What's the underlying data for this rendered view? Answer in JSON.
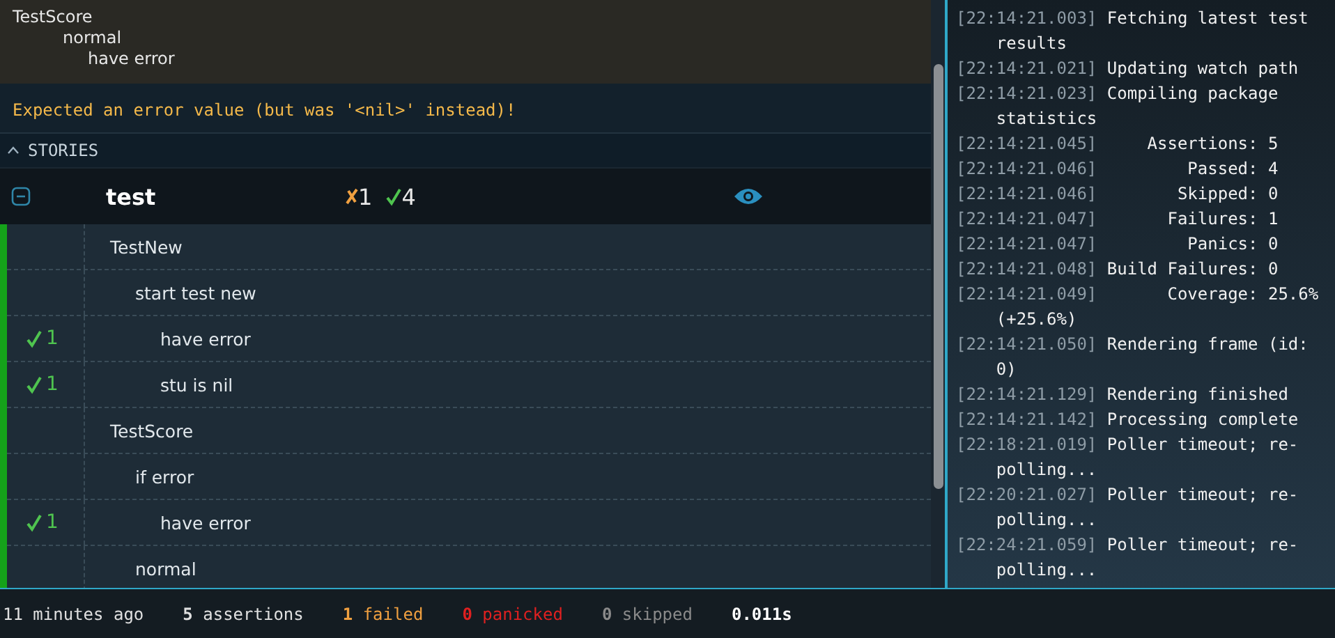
{
  "failure": {
    "lines": [
      "TestScore",
      "normal",
      "have error"
    ],
    "message": "Expected an error value (but was '<nil>' instead)!"
  },
  "stories_header": {
    "label": "STORIES",
    "expanded": true
  },
  "test": {
    "name": "test",
    "expanded": true,
    "failed": "1",
    "passed": "4"
  },
  "stories": [
    {
      "label": "TestNew",
      "children": [
        {
          "label": "start test new",
          "children": [
            {
              "label": "have error",
              "passed": "1"
            },
            {
              "label": "stu is nil",
              "passed": "1"
            }
          ]
        }
      ]
    },
    {
      "label": "TestScore",
      "children": [
        {
          "label": "if error",
          "children": [
            {
              "label": "have error",
              "passed": "1"
            }
          ]
        },
        {
          "label": "normal"
        }
      ]
    }
  ],
  "log": [
    {
      "time": "[22:14:21.003]",
      "kind": "msg",
      "text": "Fetching latest test results"
    },
    {
      "time": "[22:14:21.021]",
      "kind": "msg",
      "text": "Updating watch path"
    },
    {
      "time": "[22:14:21.023]",
      "kind": "msg",
      "text": "Compiling package statistics"
    },
    {
      "time": "[22:14:21.045]",
      "kind": "stat",
      "text": "Assertions:",
      "value": "5"
    },
    {
      "time": "[22:14:21.046]",
      "kind": "stat",
      "text": "Passed:",
      "value": "4"
    },
    {
      "time": "[22:14:21.046]",
      "kind": "stat",
      "text": "Skipped:",
      "value": "0"
    },
    {
      "time": "[22:14:21.047]",
      "kind": "stat",
      "text": "Failures:",
      "value": "1"
    },
    {
      "time": "[22:14:21.047]",
      "kind": "stat",
      "text": "Panics:",
      "value": "0"
    },
    {
      "time": "[22:14:21.048]",
      "kind": "msg",
      "text": "Build Failures: 0"
    },
    {
      "time": "[22:14:21.049]",
      "kind": "stat",
      "text": "Coverage:",
      "value": "25.6% (+25.6%)"
    },
    {
      "time": "[22:14:21.050]",
      "kind": "msg",
      "text": "Rendering frame (id: 0)"
    },
    {
      "time": "[22:14:21.129]",
      "kind": "msg",
      "text": "Rendering finished"
    },
    {
      "time": "[22:14:21.142]",
      "kind": "msg",
      "text": "Processing complete"
    },
    {
      "time": "[22:18:21.019]",
      "kind": "msg",
      "text": "Poller timeout; re-polling..."
    },
    {
      "time": "[22:20:21.027]",
      "kind": "msg",
      "text": "Poller timeout; re-polling..."
    },
    {
      "time": "[22:24:21.059]",
      "kind": "msg",
      "text": "Poller timeout; re-polling..."
    }
  ],
  "status_bar": [
    {
      "kind": "time",
      "text": "11 minutes ago"
    },
    {
      "kind": "assertions",
      "text": "**5** assertions"
    },
    {
      "kind": "failed",
      "text": "**1** failed"
    },
    {
      "kind": "panicked",
      "text": "**0** panicked"
    },
    {
      "kind": "skipped",
      "text": "**0** skipped"
    },
    {
      "kind": "duration",
      "text": "0.011s"
    }
  ]
}
